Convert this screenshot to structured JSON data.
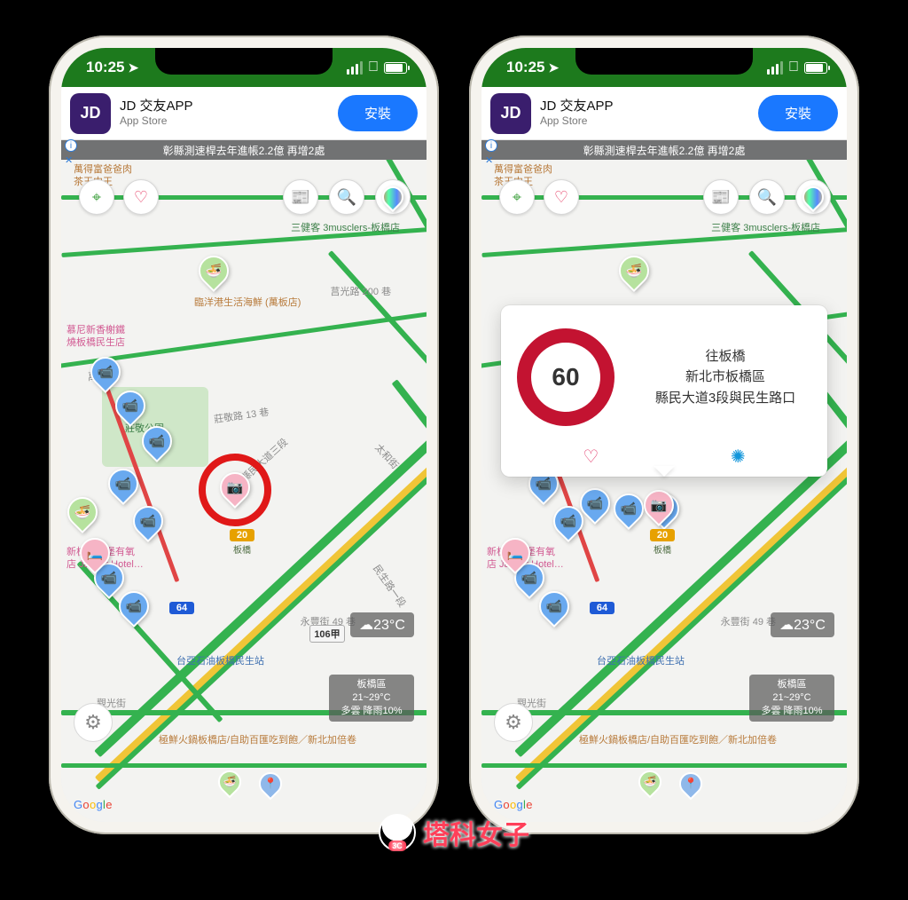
{
  "statusbar": {
    "time": "10:25"
  },
  "ad": {
    "icon_text": "JD",
    "title": "JD 交友APP",
    "subtitle": "App Store",
    "button": "安裝"
  },
  "ticker": "彰縣測速桿去年進帳2.2億 再增2處",
  "toolbar_icons": {
    "locate": "locate",
    "heart": "favorite",
    "news": "news",
    "lens": "search",
    "poi": "poi-layers"
  },
  "map_labels": {
    "muscle_shop": "三健客 3musclers-板橋店",
    "lane200": "莒光路 200 巷",
    "restaurant_pin": "臨洋港生活海鮮 (萬板店)",
    "park": "莊敬公園",
    "wanban": "萬板路",
    "zhuangjing13": "莊敬路 13 巷",
    "xianmin3": "縣民大道三段",
    "taihe": "太和街",
    "yongfeng49": "永豐街 49 巷",
    "gasstation": "台亞石油板橋民生站",
    "guanguang": "觀光街",
    "hotel1": "慕尼新香榭鐵",
    "hotel2": "燒板橋民生店",
    "hotel3": "新板傑仕堡有氧",
    "hotel4": "店 Jasper Hotel…",
    "bbq": "萬得富爸爸肉",
    "tea": "茶王中王",
    "hotspot": "極鮮火鍋板橋店/自助百匯吃到飽／新北加倍卷",
    "route20": "20",
    "route20_label": "板橋",
    "route64": "64",
    "route106a": "106甲",
    "minsheng": "民生路一段"
  },
  "weather": {
    "now_temp": "23°C",
    "now_icon": "☁",
    "area": "板橋區",
    "range": "21~29°C",
    "desc": "多雲 降雨10%"
  },
  "popup": {
    "speed": "60",
    "line1": "往板橋",
    "line2": "新北市板橋區",
    "line3": "縣民大道3段與民生路口"
  },
  "google": [
    "G",
    "o",
    "o",
    "g",
    "l",
    "e"
  ],
  "watermark": "塔科女子"
}
